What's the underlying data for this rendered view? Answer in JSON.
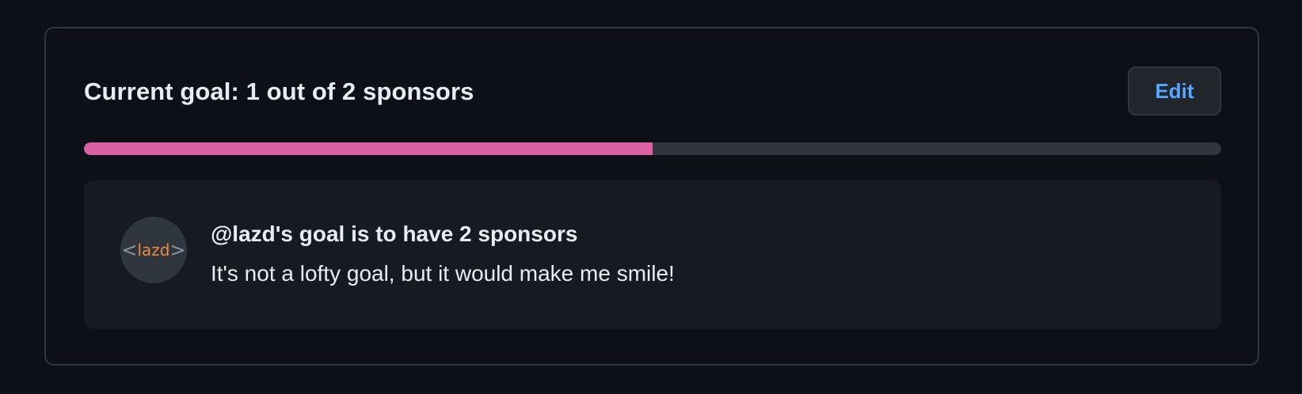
{
  "goal": {
    "title": "Current goal: 1 out of 2 sponsors",
    "edit_label": "Edit",
    "current": 1,
    "target": 2,
    "progress_fraction": 0.5,
    "progress_color": "#db61a2",
    "track_color": "#30363d",
    "accent_color": "#58a6ff"
  },
  "panel": {
    "avatar_text": "lazd",
    "avatar_open_bracket": "<",
    "avatar_close_bracket": ">",
    "heading": "@lazd's goal is to have 2 sponsors",
    "message": "It's not a lofty goal, but it would make me smile!"
  }
}
